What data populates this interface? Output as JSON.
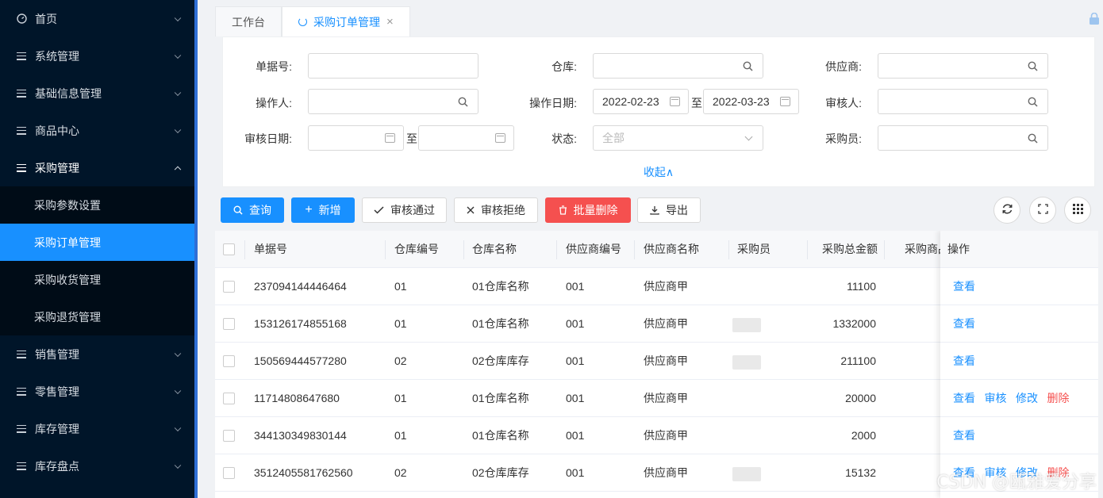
{
  "sidebar": {
    "items": [
      {
        "label": "首页",
        "icon": "dashboard-icon"
      },
      {
        "label": "系统管理",
        "icon": "menu-icon"
      },
      {
        "label": "基础信息管理",
        "icon": "menu-icon"
      },
      {
        "label": "商品中心",
        "icon": "menu-icon"
      },
      {
        "label": "采购管理",
        "icon": "menu-icon",
        "open": true
      },
      {
        "label": "销售管理",
        "icon": "menu-icon"
      },
      {
        "label": "零售管理",
        "icon": "menu-icon"
      },
      {
        "label": "库存管理",
        "icon": "menu-icon"
      },
      {
        "label": "库存盘点",
        "icon": "menu-icon"
      }
    ],
    "purchase_sub": [
      "采购参数设置",
      "采购订单管理",
      "采购收货管理",
      "采购退货管理"
    ]
  },
  "tabs": [
    {
      "label": "工作台"
    },
    {
      "label": "采购订单管理",
      "close": "×"
    }
  ],
  "filters": {
    "doc_no_label": "单据号:",
    "warehouse_label": "仓库:",
    "supplier_label": "供应商:",
    "operator_label": "操作人:",
    "op_date_label": "操作日期:",
    "op_date_from": "2022-02-23",
    "op_date_to": "2022-03-23",
    "auditor_label": "审核人:",
    "audit_date_label": "审核日期:",
    "to_text": "至",
    "status_label": "状态:",
    "status_value": "全部",
    "buyer_label": "采购员:",
    "collapse": "收起∧"
  },
  "toolbar": {
    "query": "查询",
    "add": "新增",
    "approve": "审核通过",
    "reject": "审核拒绝",
    "batch_delete": "批量删除",
    "export": "导出"
  },
  "table": {
    "headers": [
      "单据号",
      "仓库编号",
      "仓库名称",
      "供应商编号",
      "供应商名称",
      "采购员",
      "采购总金额",
      "采购商品",
      "操作"
    ],
    "rows": [
      {
        "no": "237094144446464",
        "wh_code": "01",
        "wh_name": "01仓库名称",
        "sup_code": "001",
        "sup_name": "供应商甲",
        "amount": "11100",
        "ops": [
          "查看"
        ]
      },
      {
        "no": "153126174855168",
        "wh_code": "01",
        "wh_name": "01仓库名称",
        "sup_code": "001",
        "sup_name": "供应商甲",
        "amount": "1332000",
        "ops": [
          "查看"
        ]
      },
      {
        "no": "150569444577280",
        "wh_code": "02",
        "wh_name": "02仓库库存",
        "sup_code": "001",
        "sup_name": "供应商甲",
        "amount": "211100",
        "ops": [
          "查看"
        ]
      },
      {
        "no": "11714808647680",
        "wh_code": "01",
        "wh_name": "01仓库名称",
        "sup_code": "001",
        "sup_name": "供应商甲",
        "amount": "20000",
        "ops": [
          "查看",
          "审核",
          "修改",
          "删除"
        ]
      },
      {
        "no": "344130349830144",
        "wh_code": "01",
        "wh_name": "01仓库名称",
        "sup_code": "001",
        "sup_name": "供应商甲",
        "amount": "2000",
        "ops": [
          "查看"
        ]
      },
      {
        "no": "3512405581762560",
        "wh_code": "02",
        "wh_name": "02仓库库存",
        "sup_code": "001",
        "sup_name": "供应商甲",
        "amount": "15132",
        "ops": [
          "查看",
          "审核",
          "修改",
          "删除"
        ]
      }
    ]
  },
  "watermark": "CSDN @瓯雅爱分享",
  "colors": {
    "primary": "#1890ff",
    "danger": "#f5504f",
    "sidebar": "#001529"
  }
}
